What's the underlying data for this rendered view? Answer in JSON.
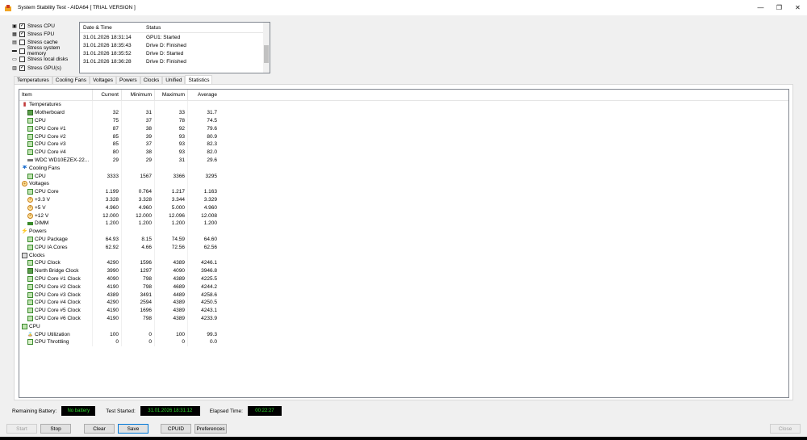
{
  "window": {
    "title": "System Stability Test - AIDA64  [ TRIAL VERSION ]",
    "minimize": "—",
    "maximize": "❐",
    "close": "✕"
  },
  "stress_options": [
    {
      "label": "Stress CPU",
      "checked": true,
      "icon": "cpu-icon"
    },
    {
      "label": "Stress FPU",
      "checked": true,
      "icon": "fpu-icon"
    },
    {
      "label": "Stress cache",
      "checked": false,
      "icon": "cache-icon"
    },
    {
      "label": "Stress system memory",
      "checked": false,
      "icon": "memory-icon"
    },
    {
      "label": "Stress local disks",
      "checked": false,
      "icon": "disk-icon"
    },
    {
      "label": "Stress GPU(s)",
      "checked": true,
      "icon": "gpu-icon"
    }
  ],
  "log": {
    "header_date": "Date & Time",
    "header_status": "Status",
    "rows": [
      {
        "date": "31.01.2026 18:31:14",
        "status": "GPU1: Started"
      },
      {
        "date": "31.01.2026 18:35:43",
        "status": "Drive D: Finished"
      },
      {
        "date": "31.01.2026 18:35:52",
        "status": "Drive D: Started"
      },
      {
        "date": "31.01.2026 18:36:28",
        "status": "Drive D: Finished"
      }
    ]
  },
  "tabs": [
    "Temperatures",
    "Cooling Fans",
    "Voltages",
    "Powers",
    "Clocks",
    "Unified",
    "Statistics"
  ],
  "active_tab": "Statistics",
  "grid": {
    "headers": {
      "item": "Item",
      "current": "Current",
      "minimum": "Minimum",
      "maximum": "Maximum",
      "average": "Average"
    },
    "rows": [
      {
        "type": "group",
        "label": "Temperatures",
        "icon": "temp"
      },
      {
        "type": "item",
        "label": "Motherboard",
        "icon": "mb",
        "cur": "32",
        "min": "31",
        "max": "33",
        "avg": "31.7"
      },
      {
        "type": "item",
        "label": "CPU",
        "icon": "cpu",
        "cur": "75",
        "min": "37",
        "max": "78",
        "avg": "74.5"
      },
      {
        "type": "item",
        "label": "CPU Core #1",
        "icon": "cpu",
        "cur": "87",
        "min": "38",
        "max": "92",
        "avg": "79.6"
      },
      {
        "type": "item",
        "label": "CPU Core #2",
        "icon": "cpu",
        "cur": "85",
        "min": "39",
        "max": "93",
        "avg": "80.9"
      },
      {
        "type": "item",
        "label": "CPU Core #3",
        "icon": "cpu",
        "cur": "85",
        "min": "37",
        "max": "93",
        "avg": "82.3"
      },
      {
        "type": "item",
        "label": "CPU Core #4",
        "icon": "cpu",
        "cur": "80",
        "min": "38",
        "max": "93",
        "avg": "82.0"
      },
      {
        "type": "item",
        "label": "WDC WD10EZEX-22...",
        "icon": "disk",
        "cur": "29",
        "min": "29",
        "max": "31",
        "avg": "29.6"
      },
      {
        "type": "group",
        "label": "Cooling Fans",
        "icon": "fan"
      },
      {
        "type": "item",
        "label": "CPU",
        "icon": "cpu",
        "cur": "3333",
        "min": "1567",
        "max": "3366",
        "avg": "3295"
      },
      {
        "type": "group",
        "label": "Voltages",
        "icon": "volt"
      },
      {
        "type": "item",
        "label": "CPU Core",
        "icon": "cpu",
        "cur": "1.199",
        "min": "0.764",
        "max": "1.217",
        "avg": "1.163"
      },
      {
        "type": "item",
        "label": "+3.3 V",
        "icon": "volt",
        "cur": "3.328",
        "min": "3.328",
        "max": "3.344",
        "avg": "3.329"
      },
      {
        "type": "item",
        "label": "+5 V",
        "icon": "volt",
        "cur": "4.960",
        "min": "4.960",
        "max": "5.000",
        "avg": "4.960"
      },
      {
        "type": "item",
        "label": "+12 V",
        "icon": "volt",
        "cur": "12.000",
        "min": "12.000",
        "max": "12.096",
        "avg": "12.008"
      },
      {
        "type": "item",
        "label": "DIMM",
        "icon": "dimm",
        "cur": "1.200",
        "min": "1.200",
        "max": "1.200",
        "avg": "1.200"
      },
      {
        "type": "group",
        "label": "Powers",
        "icon": "power"
      },
      {
        "type": "item",
        "label": "CPU Package",
        "icon": "cpu",
        "cur": "64.93",
        "min": "8.15",
        "max": "74.59",
        "avg": "64.60"
      },
      {
        "type": "item",
        "label": "CPU IA Cores",
        "icon": "cpu",
        "cur": "62.92",
        "min": "4.66",
        "max": "72.56",
        "avg": "62.56"
      },
      {
        "type": "group",
        "label": "Clocks",
        "icon": "clock"
      },
      {
        "type": "item",
        "label": "CPU Clock",
        "icon": "cpu",
        "cur": "4290",
        "min": "1596",
        "max": "4389",
        "avg": "4246.1"
      },
      {
        "type": "item",
        "label": "North Bridge Clock",
        "icon": "mb",
        "cur": "3990",
        "min": "1297",
        "max": "4090",
        "avg": "3946.8"
      },
      {
        "type": "item",
        "label": "CPU Core #1 Clock",
        "icon": "cpu",
        "cur": "4090",
        "min": "798",
        "max": "4389",
        "avg": "4225.5"
      },
      {
        "type": "item",
        "label": "CPU Core #2 Clock",
        "icon": "cpu",
        "cur": "4190",
        "min": "798",
        "max": "4689",
        "avg": "4244.2"
      },
      {
        "type": "item",
        "label": "CPU Core #3 Clock",
        "icon": "cpu",
        "cur": "4389",
        "min": "3491",
        "max": "4489",
        "avg": "4258.6"
      },
      {
        "type": "item",
        "label": "CPU Core #4 Clock",
        "icon": "cpu",
        "cur": "4290",
        "min": "2594",
        "max": "4389",
        "avg": "4250.5"
      },
      {
        "type": "item",
        "label": "CPU Core #5 Clock",
        "icon": "cpu",
        "cur": "4190",
        "min": "1696",
        "max": "4389",
        "avg": "4243.1"
      },
      {
        "type": "item",
        "label": "CPU Core #6 Clock",
        "icon": "cpu",
        "cur": "4190",
        "min": "798",
        "max": "4389",
        "avg": "4233.9"
      },
      {
        "type": "group",
        "label": "CPU",
        "icon": "cpu"
      },
      {
        "type": "item",
        "label": "CPU Utilization",
        "icon": "hourglass",
        "cur": "100",
        "min": "0",
        "max": "100",
        "avg": "99.3"
      },
      {
        "type": "item",
        "label": "CPU Throttling",
        "icon": "throt",
        "cur": "0",
        "min": "0",
        "max": "0",
        "avg": "0.0"
      }
    ]
  },
  "status": {
    "battery_label": "Remaining Battery:",
    "battery_value": "No battery",
    "started_label": "Test Started:",
    "started_value": "31.01.2026 18:31:12",
    "elapsed_label": "Elapsed Time:",
    "elapsed_value": "00:22:27"
  },
  "buttons": {
    "start": "Start",
    "stop": "Stop",
    "clear": "Clear",
    "save": "Save",
    "cpuid": "CPUID",
    "preferences": "Preferences",
    "close": "Close"
  }
}
